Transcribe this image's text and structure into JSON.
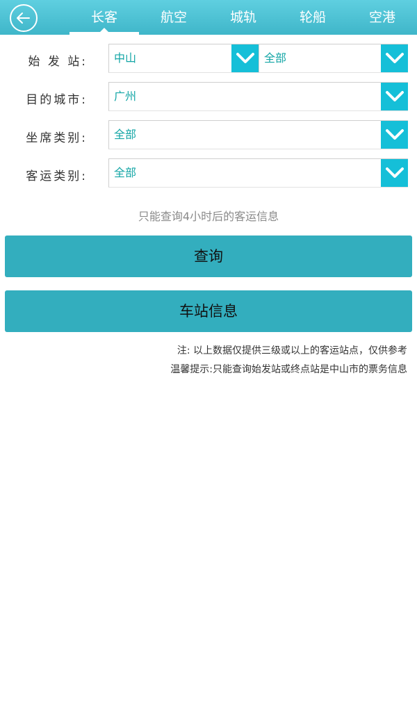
{
  "header": {
    "tabs": [
      {
        "label": "长客",
        "active": true
      },
      {
        "label": "航空",
        "active": false
      },
      {
        "label": "城轨",
        "active": false
      },
      {
        "label": "轮船",
        "active": false
      },
      {
        "label": "空港",
        "active": false
      }
    ]
  },
  "form": {
    "departure": {
      "label": "始 发 站:",
      "value1": "中山",
      "value2": "全部"
    },
    "destination": {
      "label": "目的城市:",
      "value": "广州"
    },
    "seat_type": {
      "label": "坐席类别:",
      "value": "全部"
    },
    "service_type": {
      "label": "客运类别:",
      "value": "全部"
    }
  },
  "hint": "只能查询4小时后的客运信息",
  "buttons": {
    "query": "查询",
    "station_info": "车站信息"
  },
  "notes": {
    "note1": "注: 以上数据仅提供三级或以上的客运站点，仅供参考",
    "note2": "温馨提示:只能查询始发站或终点站是中山市的票务信息"
  },
  "colors": {
    "header": "#4fc4d6",
    "accent": "#15bfd8",
    "button": "#33aebe",
    "value_text": "#14a6a6"
  }
}
